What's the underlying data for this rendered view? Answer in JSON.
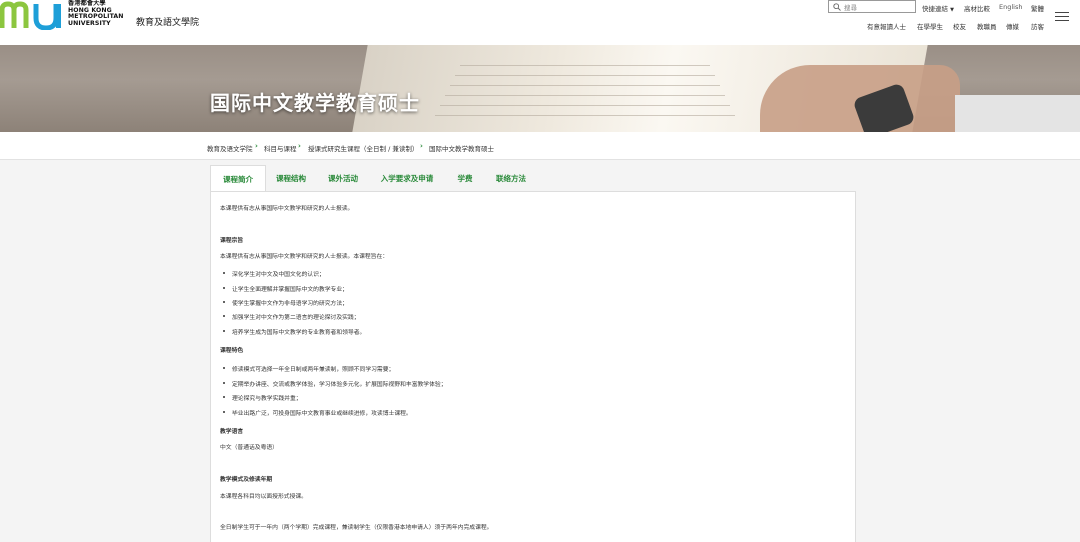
{
  "header": {
    "logo_text": "香港都會大學\nHONG KONG\nMETROPOLITAN\nUNIVERSITY",
    "school_name": "教育及語文學院",
    "search_placeholder": "搜尋",
    "quick_links": "快捷連結",
    "alumni": "高材比較",
    "english": "English",
    "traditional": "繁體",
    "subnav": [
      "有意報讀人士",
      "在學學生",
      "校友",
      "教職員",
      "傳媒",
      "訪客"
    ]
  },
  "banner": {
    "title": "国际中文教学教育硕士"
  },
  "breadcrumb": [
    "教育及语文学院",
    "科目与课程",
    "授课式研究生课程（全日制 / 兼读制）",
    "国际中文教学教育硕士"
  ],
  "tabs": [
    "课程简介",
    "课程结构",
    "课外活动",
    "入学要求及申请",
    "学费",
    "联络方法"
  ],
  "content": {
    "intro": "本课程供有志从事国际中文教学和研究的人士报读。",
    "aim_heading": "课程宗旨",
    "aim_intro": "本课程供有志从事国际中文教学和研究的人士报读。本课程旨在：",
    "aims": [
      "深化学生对中文及中国文化的认识；",
      "让学生全面理解并掌握国际中文的教学专业；",
      "使学生掌握中文作为非母语学习的研究方法；",
      "加强学生对中文作为第二语言的理论探讨及实践；",
      "培养学生成为国际中文教学的专业教育者和领导者。"
    ],
    "feature_heading": "课程特色",
    "features": [
      "修读模式可选择一年全日制或两年兼读制，照顾不同学习需要；",
      "定期举办讲座、交流或教学体验，学习体验多元化，扩展国际视野和丰富教学体验；",
      "理论探究与教学实践并重；",
      "毕业出路广泛，可投身国际中文教育事业或继续进修，攻读博士课程。"
    ],
    "lang_heading": "教学语言",
    "lang": "中文（普通话及粤语）",
    "mode_heading": "教学模式及修读年期",
    "mode": "本课程各科目均以面授形式授课。",
    "duration": "全日制学生可于一年内（两个学期）完成课程，兼读制学生（仅限香港本地申请人）须于两年内完成课程。"
  },
  "colors": {
    "accent": "#2a8a3a",
    "logo_green": "#8cc63f",
    "logo_blue": "#1e9fd8"
  }
}
